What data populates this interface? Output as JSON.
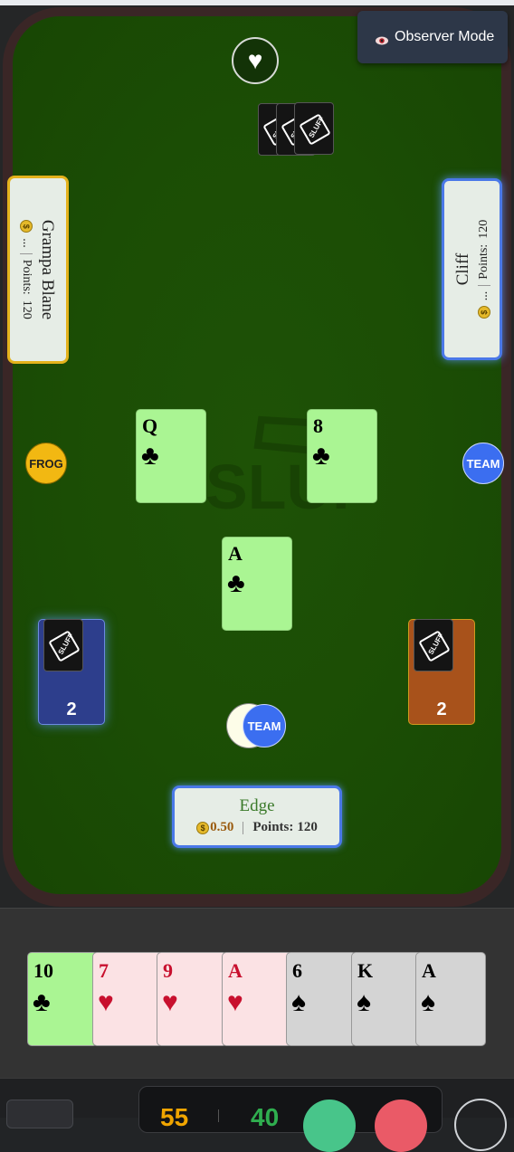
{
  "observer": {
    "label": "Observer Mode",
    "icon": "eye-icon"
  },
  "trump": {
    "symbol": "♥",
    "icon": "heart-icon"
  },
  "deck": {
    "logo_text": "SLUFF",
    "count_shown": 3
  },
  "watermark": {
    "text": "SLUFF"
  },
  "players": {
    "left": {
      "name": "Grampa Blane",
      "coins": "...",
      "points_label": "Points:",
      "points": "120"
    },
    "right": {
      "name": "Cliff",
      "coins": "...",
      "points_label": "Points:",
      "points": "120"
    },
    "bottom": {
      "name": "Edge",
      "coins": "0.50",
      "points_label": "Points:",
      "points": "120"
    }
  },
  "chips": {
    "frog": "FROG",
    "team_right": "TEAM",
    "team_bottom": "TEAM"
  },
  "played_cards": [
    {
      "rank": "Q",
      "suit": "♣",
      "color": "#000000"
    },
    {
      "rank": "8",
      "suit": "♣",
      "color": "#000000"
    },
    {
      "rank": "A",
      "suit": "♣",
      "color": "#000000"
    }
  ],
  "piles": {
    "left_count": "2",
    "right_count": "2"
  },
  "hand": [
    {
      "rank": "10",
      "suit": "♣",
      "color": "#000000",
      "bg": "#aaf593"
    },
    {
      "rank": "7",
      "suit": "♥",
      "color": "#c8102e",
      "bg": "#fbe2e4"
    },
    {
      "rank": "9",
      "suit": "♥",
      "color": "#c8102e",
      "bg": "#fbe2e4"
    },
    {
      "rank": "A",
      "suit": "♥",
      "color": "#c8102e",
      "bg": "#fbe2e4"
    },
    {
      "rank": "6",
      "suit": "♠",
      "color": "#000000",
      "bg": "#d4d4d4"
    },
    {
      "rank": "K",
      "suit": "♠",
      "color": "#000000",
      "bg": "#d4d4d4"
    },
    {
      "rank": "A",
      "suit": "♠",
      "color": "#000000",
      "bg": "#d4d4d4"
    }
  ],
  "bottom_bar": {
    "value_a": "55",
    "value_b": "40"
  },
  "colors": {
    "felt": "#1b4d05",
    "team_blue": "#3b6ef0",
    "frog_yellow": "#f2b812",
    "accent_red": "#c8102e"
  }
}
